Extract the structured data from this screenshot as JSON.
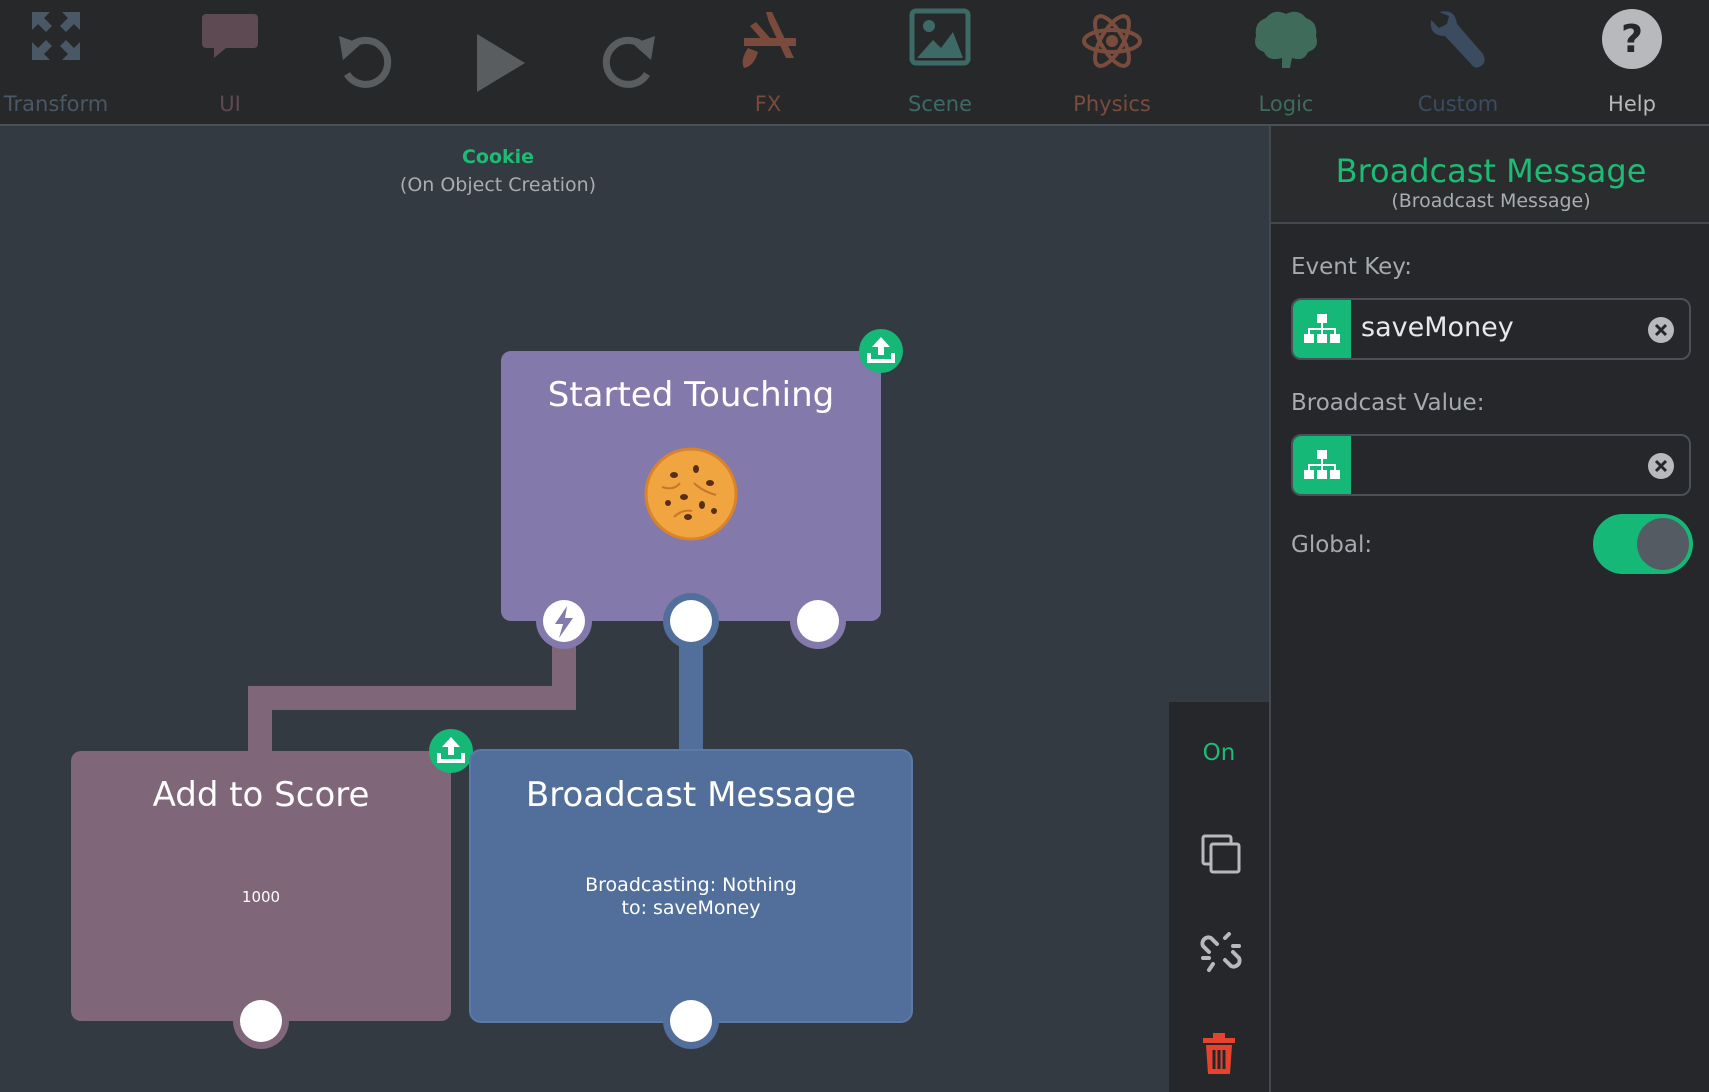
{
  "toolbar": {
    "items": [
      {
        "label": "Transform",
        "icon": "expand-arrows-icon",
        "color": "#4a5866"
      },
      {
        "label": "UI",
        "icon": "speech-bubble-icon",
        "color": "#5e4a52"
      },
      {
        "label": "",
        "icon": "undo-icon",
        "color": "#5a5d60"
      },
      {
        "label": "",
        "icon": "play-icon",
        "color": "#5a5d60"
      },
      {
        "label": "",
        "icon": "redo-icon",
        "color": "#5a5d60"
      },
      {
        "label": "FX",
        "icon": "paintbrush-icon",
        "color": "#7a4a3c"
      },
      {
        "label": "Scene",
        "icon": "image-icon",
        "color": "#3d6a66"
      },
      {
        "label": "Physics",
        "icon": "atom-icon",
        "color": "#7a4c3e"
      },
      {
        "label": "Logic",
        "icon": "brain-icon",
        "color": "#3f6b5b"
      },
      {
        "label": "Custom",
        "icon": "wrench-icon",
        "color": "#3b4c61"
      },
      {
        "label": "Help",
        "icon": "help-icon",
        "color": "#b7b9bc"
      }
    ]
  },
  "canvas": {
    "object_title": "Cookie",
    "object_subtitle": "(On Object Creation)",
    "nodes": {
      "started_touching": {
        "title": "Started Touching",
        "color": "#8479ab"
      },
      "add_to_score": {
        "title": "Add to Score",
        "body": "1000",
        "color": "#7f6678"
      },
      "broadcast_message": {
        "title": "Broadcast Message",
        "body_line1": "Broadcasting: Nothing",
        "body_line2": "to: saveMoney",
        "color": "#516f9a"
      }
    }
  },
  "rail": {
    "state": "On",
    "icons": [
      "duplicate-icon",
      "unlink-icon",
      "trash-icon"
    ]
  },
  "inspector": {
    "title": "Broadcast Message",
    "subtitle": "(Broadcast Message)",
    "event_key": {
      "label": "Event Key:",
      "value": "saveMoney"
    },
    "broadcast_value": {
      "label": "Broadcast Value:",
      "value": ""
    },
    "global": {
      "label": "Global:",
      "enabled": true
    }
  },
  "colors": {
    "accent": "#16b878",
    "delete": "#e5432e"
  }
}
